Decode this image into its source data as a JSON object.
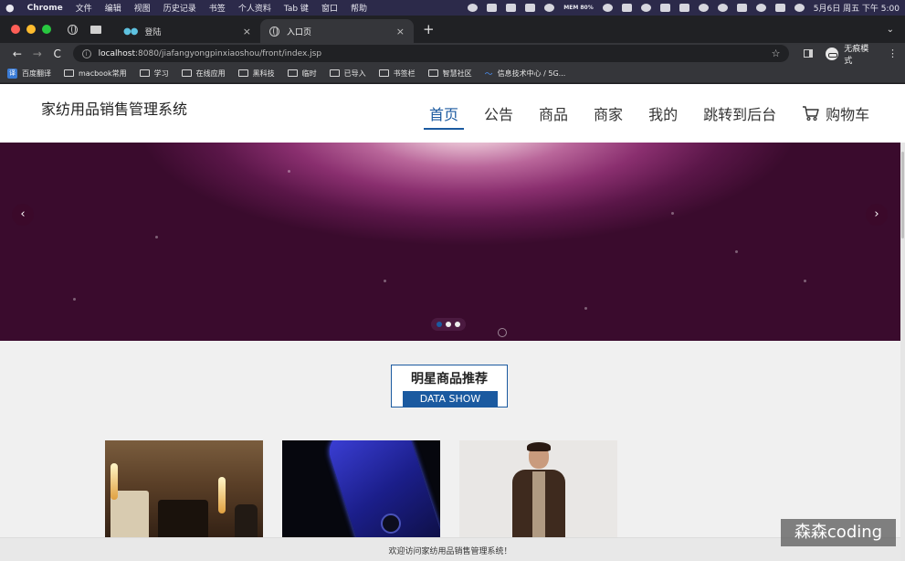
{
  "menubar": {
    "app": "Chrome",
    "items": [
      "文件",
      "编辑",
      "视图",
      "历史记录",
      "书签",
      "个人资料",
      "Tab 键",
      "窗口",
      "帮助"
    ],
    "memory": "MEM\n80%",
    "clock": "5月6日 周五 下午 5:00"
  },
  "tabs": {
    "tab1_label": "登陆",
    "tab2_label": "入口页",
    "close": "×",
    "new_tab": "+",
    "menu": "⌄"
  },
  "toolbar": {
    "back": "←",
    "forward": "→",
    "reload": "C",
    "url_host": "localhost",
    "url_rest": ":8080/jiafangyongpinxiaoshou/front/index.jsp",
    "star": "☆",
    "profile_label": "无痕模式",
    "kebab": "⋮"
  },
  "bookmarks": [
    {
      "label": "百度翻译",
      "icon": "translate-icon"
    },
    {
      "label": "macbook常用",
      "icon": "folder-icon"
    },
    {
      "label": "学习",
      "icon": "folder-icon"
    },
    {
      "label": "在线应用",
      "icon": "folder-icon"
    },
    {
      "label": "黑科技",
      "icon": "folder-icon"
    },
    {
      "label": "临时",
      "icon": "folder-icon"
    },
    {
      "label": "已导入",
      "icon": "folder-icon"
    },
    {
      "label": "书签栏",
      "icon": "folder-icon"
    },
    {
      "label": "智慧社区",
      "icon": "folder-icon"
    },
    {
      "label": "信息技术中心 / 5G...",
      "icon": "link-icon"
    }
  ],
  "site": {
    "title": "家纺用品销售管理系统",
    "nav": [
      "首页",
      "公告",
      "商品",
      "商家",
      "我的",
      "跳转到后台"
    ],
    "cart_label": "购物车",
    "accent_color": "#1b5aa0"
  },
  "banner": {
    "prev": "‹",
    "next": "›",
    "slides": 3,
    "active_slide": 1
  },
  "section": {
    "title_zh": "明星商品推荐",
    "title_en": "DATA SHOW"
  },
  "products": [
    {
      "image": "home-decor-photo"
    },
    {
      "image": "smartphone-photo"
    },
    {
      "image": "menswear-photo"
    }
  ],
  "footer": {
    "text": "欢迎访问家纺用品销售管理系统！"
  },
  "watermark": "森森coding"
}
